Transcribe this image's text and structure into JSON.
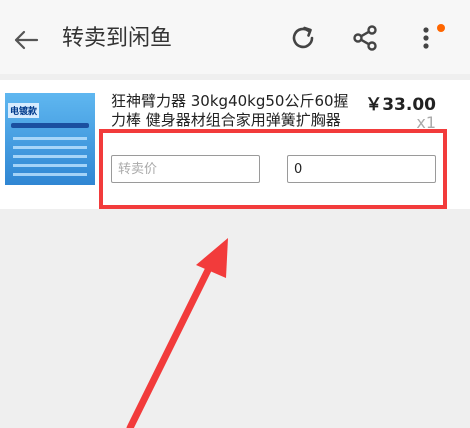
{
  "header": {
    "title": "转卖到闲鱼",
    "accent": "#ff6600"
  },
  "product": {
    "name": "狂神臂力器 30kg40kg50公斤60握力棒 健身器材组合家用弹簧扩胸器",
    "price": "￥33.00",
    "quantity": "x1",
    "thumbnail_brand": "电镀款"
  },
  "form": {
    "resale_price_placeholder": "转卖价",
    "second_value": "0"
  },
  "annotation": {
    "color": "#f23b3b"
  }
}
